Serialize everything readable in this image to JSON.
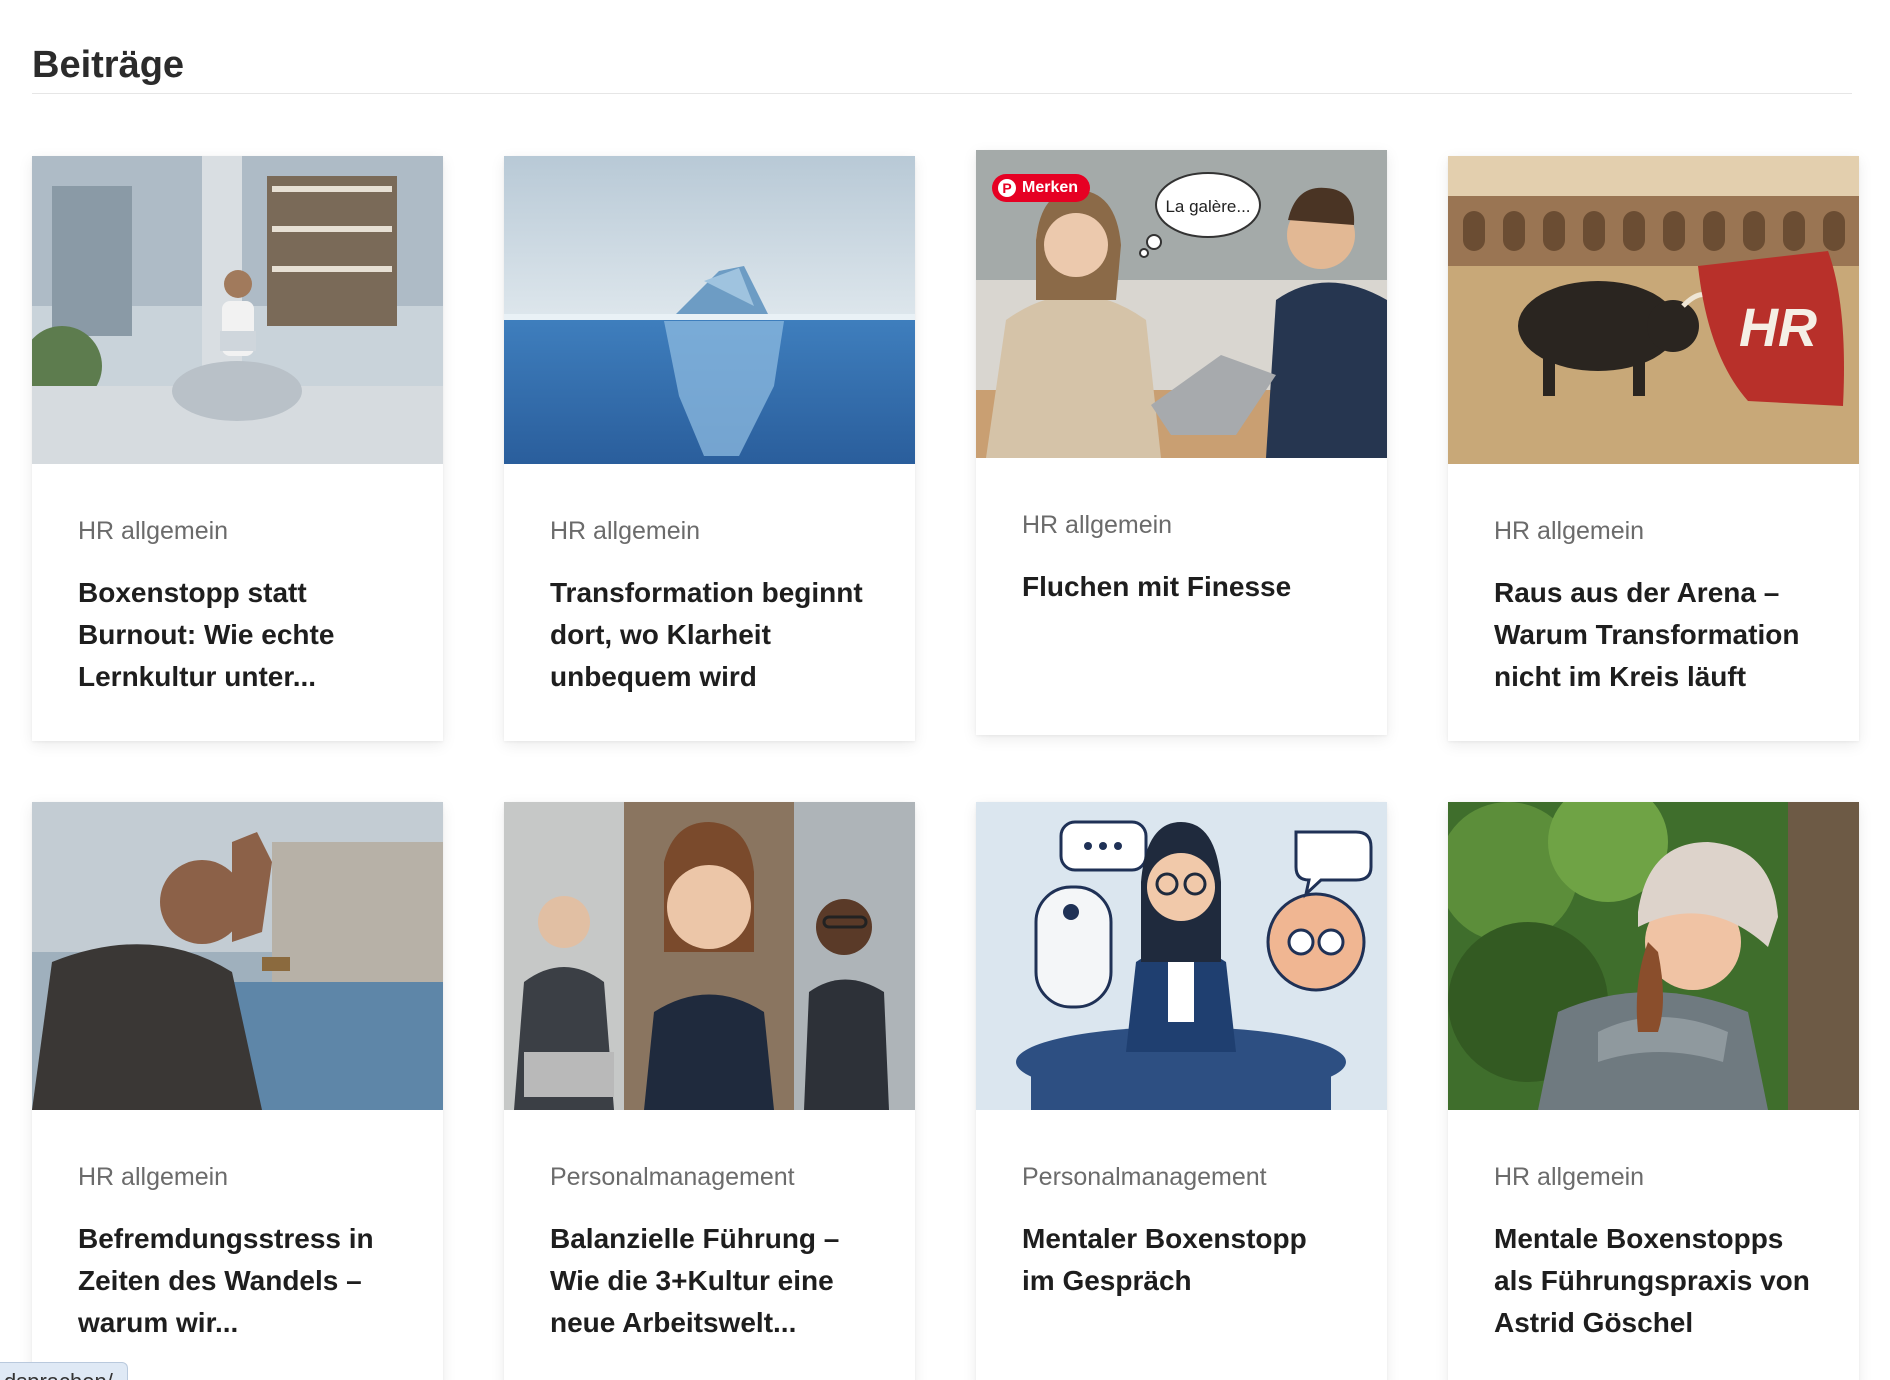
{
  "page": {
    "section_title": "Beiträge"
  },
  "pin": {
    "label": "Merken"
  },
  "status": {
    "url": "dsprachen/"
  },
  "posts": [
    {
      "category": "HR allgemein",
      "title": "Boxenstopp statt Burnout: Wie echte Lernkultur unter..."
    },
    {
      "category": "HR allgemein",
      "title": "Transformation beginnt dort, wo Klarheit unbequem wird"
    },
    {
      "category": "HR allgemein",
      "title": "Fluchen mit Finesse",
      "image_caption": "La galère..."
    },
    {
      "category": "HR allgemein",
      "title": "Raus aus der Arena – Warum Transformation nicht im Kreis läuft",
      "image_caption": "HR"
    },
    {
      "category": "HR allgemein",
      "title": "Befremdungsstress in Zeiten des Wandels – warum wir..."
    },
    {
      "category": "Personalmanagement",
      "title": "Balanzielle Führung – Wie die 3+Kultur eine neue Arbeitswelt..."
    },
    {
      "category": "Personalmanagement",
      "title": "Mentaler Boxenstopp im Gespräch"
    },
    {
      "category": "HR allgemein",
      "title": "Mentale Boxenstopps als Führungspraxis von Astrid Göschel"
    }
  ]
}
